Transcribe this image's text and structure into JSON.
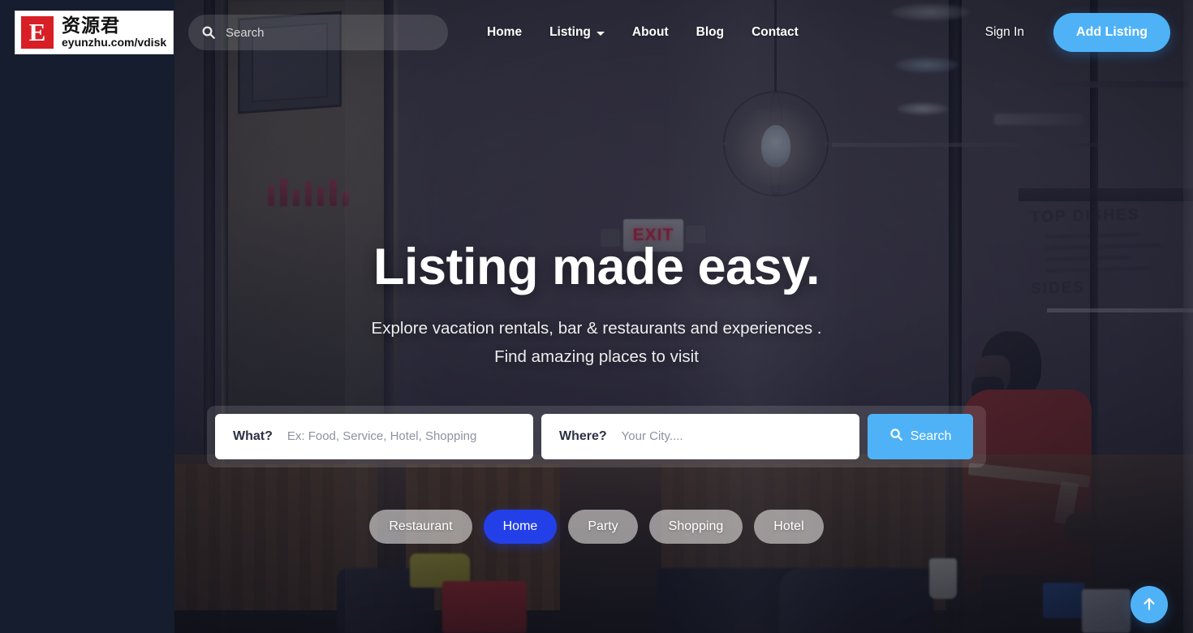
{
  "header": {
    "logo": {
      "mark_letter": "E",
      "brand_cn": "资源君",
      "url": "eyunzhu.com/vdisk"
    },
    "search": {
      "placeholder": "Search",
      "icon": "search-icon"
    },
    "nav": [
      {
        "label": "Home",
        "has_dropdown": false
      },
      {
        "label": "Listing",
        "has_dropdown": true
      },
      {
        "label": "About",
        "has_dropdown": false
      },
      {
        "label": "Blog",
        "has_dropdown": false
      },
      {
        "label": "Contact",
        "has_dropdown": false
      }
    ],
    "sign_in_label": "Sign In",
    "add_listing_label": "Add Listing"
  },
  "hero": {
    "headline": "Listing made easy.",
    "subline_1": "Explore vacation rentals, bar & restaurants and experiences .",
    "subline_2": "Find amazing places to visit"
  },
  "search_form": {
    "what_label": "What?",
    "what_placeholder": "Ex: Food, Service, Hotel, Shopping",
    "what_value": "",
    "where_label": "Where?",
    "where_placeholder": "Your City....",
    "where_value": "",
    "search_button_label": "Search",
    "search_button_icon": "search-icon"
  },
  "categories": [
    {
      "label": "Restaurant",
      "active": false
    },
    {
      "label": "Home",
      "active": true
    },
    {
      "label": "Party",
      "active": false
    },
    {
      "label": "Shopping",
      "active": false
    },
    {
      "label": "Hotel",
      "active": false
    }
  ],
  "background": {
    "exit_sign_text": "EXIT",
    "menu_board_title": "TOP DISHES",
    "menu_board_subtitle": "SIDES"
  },
  "scroll_top": {
    "icon": "arrow-up-icon",
    "label": ""
  },
  "colors": {
    "accent_blue": "#4fb2f7",
    "active_pill_blue": "#2340e8",
    "logo_red": "#d81f26",
    "page_navy": "#151d2e",
    "white": "#ffffff"
  }
}
